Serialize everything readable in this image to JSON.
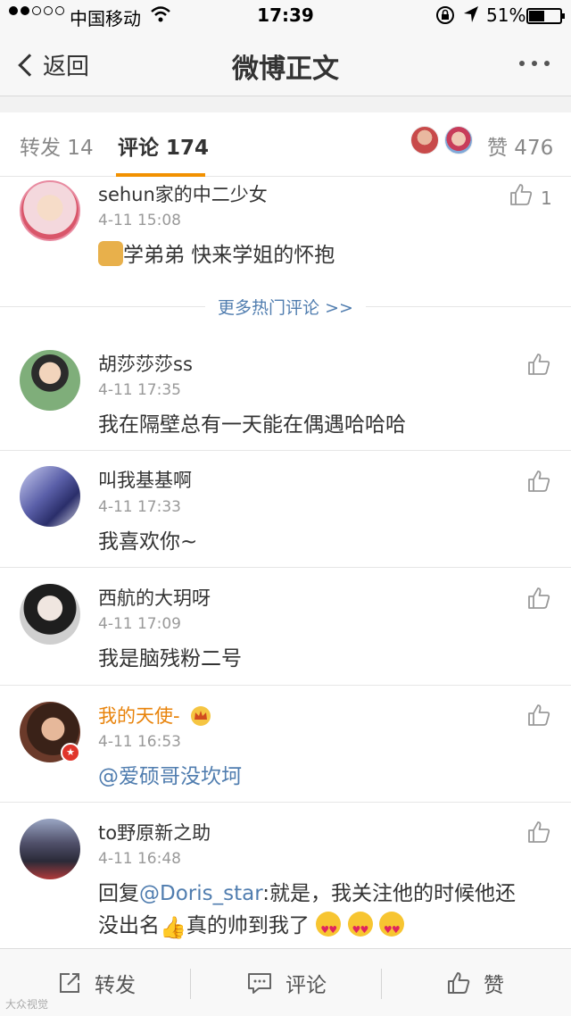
{
  "status_bar": {
    "carrier": "中国移动",
    "time": "17:39",
    "battery": "51%",
    "battery_level": 0.51
  },
  "nav": {
    "back_label": "返回",
    "title": "微博正文"
  },
  "tabs": {
    "repost": "转发 14",
    "comment": "评论 174",
    "likes": "赞 476"
  },
  "hot_comment": {
    "user": "sehun家的中二少女",
    "time": "4-11 15:08",
    "text": "学弟弟 快来学姐的怀抱",
    "like_count": "1",
    "more_label": "更多热门评论 >>"
  },
  "comments": [
    {
      "user": "胡莎莎莎ss",
      "time": "4-11 17:35",
      "text": "我在隔壁总有一天能在偶遇哈哈哈"
    },
    {
      "user": "叫我基基啊",
      "time": "4-11 17:33",
      "text": "我喜欢你~"
    },
    {
      "user": "西航的大玥呀",
      "time": "4-11 17:09",
      "text": "我是脑残粉二号"
    },
    {
      "user": "我的天使-",
      "time": "4-11 16:53",
      "text": "@爱硕哥没坎坷"
    },
    {
      "user": "to野原新之助",
      "time": "4-11 16:48",
      "reply_prefix": "回复",
      "reply_mention": "@Doris_star",
      "text_line1": ":就是，我关注他的时候他还",
      "text_line2_a": "没出名",
      "text_line2_b": "真的帅到我了"
    }
  ],
  "bottom_bar": {
    "repost": "转发",
    "comment": "评论",
    "like": "赞"
  },
  "watermark": "大众视觉",
  "colors": {
    "accent_orange": "#f29100",
    "link_blue": "#507daf",
    "vip_orange": "#e8830b"
  },
  "icons": [
    "back-chevron-icon",
    "more-dots-icon",
    "like-thumb-icon",
    "repost-icon",
    "comment-bubble-icon",
    "crown-icon"
  ]
}
